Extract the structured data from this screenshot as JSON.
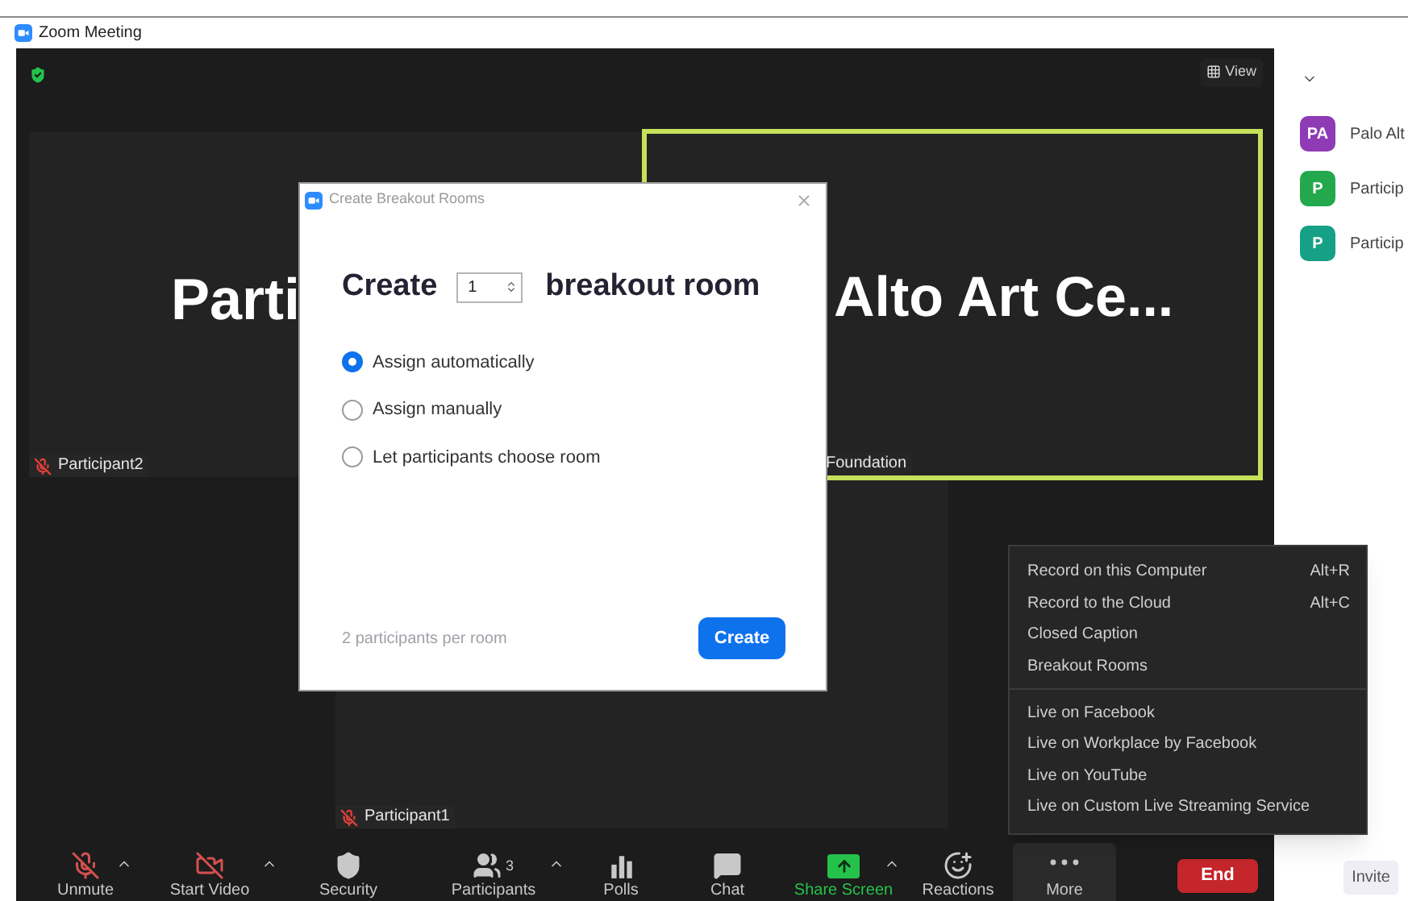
{
  "window": {
    "title": "Zoom Meeting"
  },
  "view_button": {
    "label": "View"
  },
  "tiles": [
    {
      "display_name": "Parti",
      "label": "Participant2",
      "muted": true,
      "speaking": false
    },
    {
      "display_name": "Alto Art Ce...",
      "label": "Foundation",
      "muted": false,
      "speaking": true
    },
    {
      "label": "Participant1",
      "muted": true,
      "speaking": false
    }
  ],
  "dialog": {
    "title": "Create Breakout Rooms",
    "heading_start": "Create",
    "room_count": "1",
    "heading_end": "breakout room",
    "options": [
      {
        "label": "Assign automatically",
        "selected": true
      },
      {
        "label": "Assign manually",
        "selected": false
      },
      {
        "label": "Let participants choose room",
        "selected": false
      }
    ],
    "footer_note": "2 participants per room",
    "create_button": "Create"
  },
  "more_menu": {
    "groups": [
      [
        {
          "label": "Record on this Computer",
          "shortcut": "Alt+R"
        },
        {
          "label": "Record to the Cloud",
          "shortcut": "Alt+C"
        },
        {
          "label": "Closed Caption"
        },
        {
          "label": "Breakout Rooms"
        }
      ],
      [
        {
          "label": "Live on Facebook"
        },
        {
          "label": "Live on Workplace by Facebook"
        },
        {
          "label": "Live on YouTube"
        },
        {
          "label": "Live on Custom Live Streaming Service"
        }
      ]
    ]
  },
  "toolbar": [
    {
      "kind": "mic",
      "label": "Unmute",
      "muted": true,
      "caret": true,
      "selected": false
    },
    {
      "kind": "video",
      "label": "Start Video",
      "muted": true,
      "caret": true,
      "selected": false
    },
    {
      "kind": "security",
      "label": "Security",
      "caret": false,
      "selected": false
    },
    {
      "kind": "participants",
      "label": "Participants",
      "count": "3",
      "caret": true,
      "selected": false
    },
    {
      "kind": "polls",
      "label": "Polls",
      "caret": false,
      "selected": false
    },
    {
      "kind": "chat",
      "label": "Chat",
      "caret": false,
      "selected": false
    },
    {
      "kind": "share",
      "label": "Share Screen",
      "caret": true,
      "selected": false
    },
    {
      "kind": "reactions",
      "label": "Reactions",
      "caret": false,
      "selected": false
    },
    {
      "kind": "more",
      "label": "More",
      "caret": false,
      "selected": true
    }
  ],
  "end_button": "End",
  "sidebar": {
    "participants": [
      {
        "initials": "PA",
        "name": "Palo Alt",
        "color": "#8e3bb5"
      },
      {
        "initials": "P",
        "name": "Particip",
        "color": "#23a84e"
      },
      {
        "initials": "P",
        "name": "Particip",
        "color": "#16a085"
      }
    ],
    "invite_button": "Invite"
  }
}
